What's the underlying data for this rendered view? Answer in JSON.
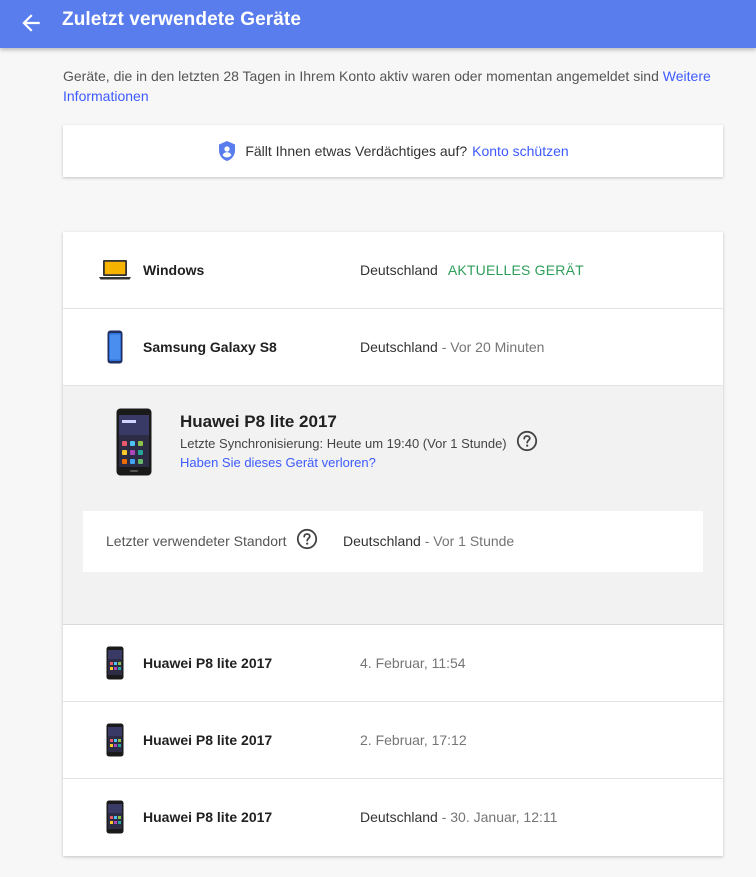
{
  "header": {
    "title": "Zuletzt verwendete Geräte",
    "back_icon": "arrow-back-icon"
  },
  "intro": {
    "text": "Geräte, die in den letzten 28 Tagen in Ihrem Konto aktiv waren oder momentan angemeldet sind ",
    "link": "Weitere Informationen"
  },
  "notice": {
    "icon": "shield-person-icon",
    "text": "Fällt Ihnen etwas Verdächtiges auf?",
    "link": "Konto schützen"
  },
  "devices": [
    {
      "name": "Windows",
      "location": "Deutschland",
      "status": "AKTUELLES GERÄT",
      "icon": "laptop-icon"
    },
    {
      "name": "Samsung Galaxy S8",
      "location": "Deutschland",
      "time": " - Vor 20 Minuten",
      "icon": "samsung-phone-icon"
    },
    {
      "name": "Huawei P8 lite 2017",
      "location": "",
      "time": "4. Februar, 11:54",
      "icon": "huawei-phone-icon"
    },
    {
      "name": "Huawei P8 lite 2017",
      "location": "",
      "time": "2. Februar, 17:12",
      "icon": "huawei-phone-icon"
    },
    {
      "name": "Huawei P8 lite 2017",
      "location": "Deutschland",
      "time": " - 30. Januar, 12:11",
      "icon": "huawei-phone-icon"
    }
  ],
  "expanded": {
    "name": "Huawei P8 lite 2017",
    "sync": "Letzte Synchronisierung: Heute um 19:40 (Vor 1 Stunde)",
    "lost_link": "Haben Sie dieses Gerät verloren?",
    "location_label": "Letzter verwendeter Standort",
    "location": "Deutschland",
    "location_time": " - Vor 1 Stunde",
    "icon": "huawei-phone-large-icon"
  },
  "colors": {
    "header": "#5a7ded",
    "link": "#3d5afe",
    "current_device": "#2e9e5b"
  }
}
